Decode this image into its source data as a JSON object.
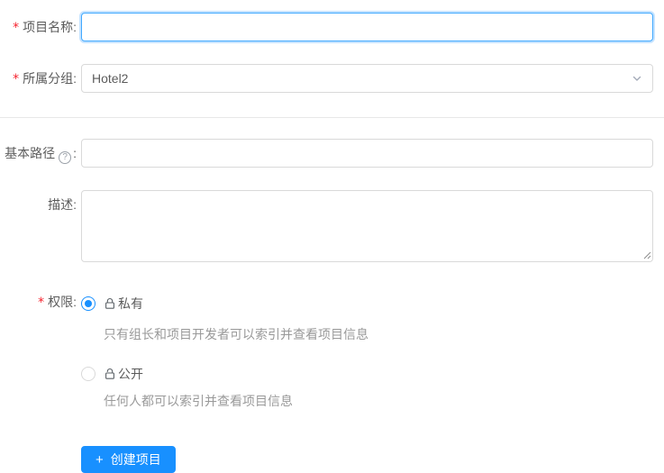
{
  "required_marker": "*",
  "colors": {
    "primary": "#1890ff",
    "focus_border": "#40a9ff",
    "input_border": "#d9d9d9",
    "divider": "#e8e8e8",
    "required_red": "#f5222d",
    "label_text": "rgba(0,0,0,0.65)",
    "muted_text": "#999999"
  },
  "form": {
    "project_name": {
      "label": "项目名称:",
      "value": "",
      "required": true,
      "focused": true
    },
    "group": {
      "label": "所属分组:",
      "value": "Hotel2",
      "required": true,
      "chevron_icon": "chevron-down"
    },
    "base_path": {
      "label": "基本路径",
      "colon": ":",
      "help_glyph": "?",
      "value": "",
      "required": false
    },
    "description": {
      "label": "描述:",
      "value": "",
      "required": false
    },
    "permission": {
      "label": "权限:",
      "required": true,
      "options": [
        {
          "label": "私有",
          "icon": "lock",
          "selected": true,
          "description": "只有组长和项目开发者可以索引并查看项目信息"
        },
        {
          "label": "公开",
          "icon": "unlock",
          "selected": false,
          "description": "任何人都可以索引并查看项目信息"
        }
      ]
    },
    "submit": {
      "plus": "+",
      "label": "创建项目"
    }
  }
}
